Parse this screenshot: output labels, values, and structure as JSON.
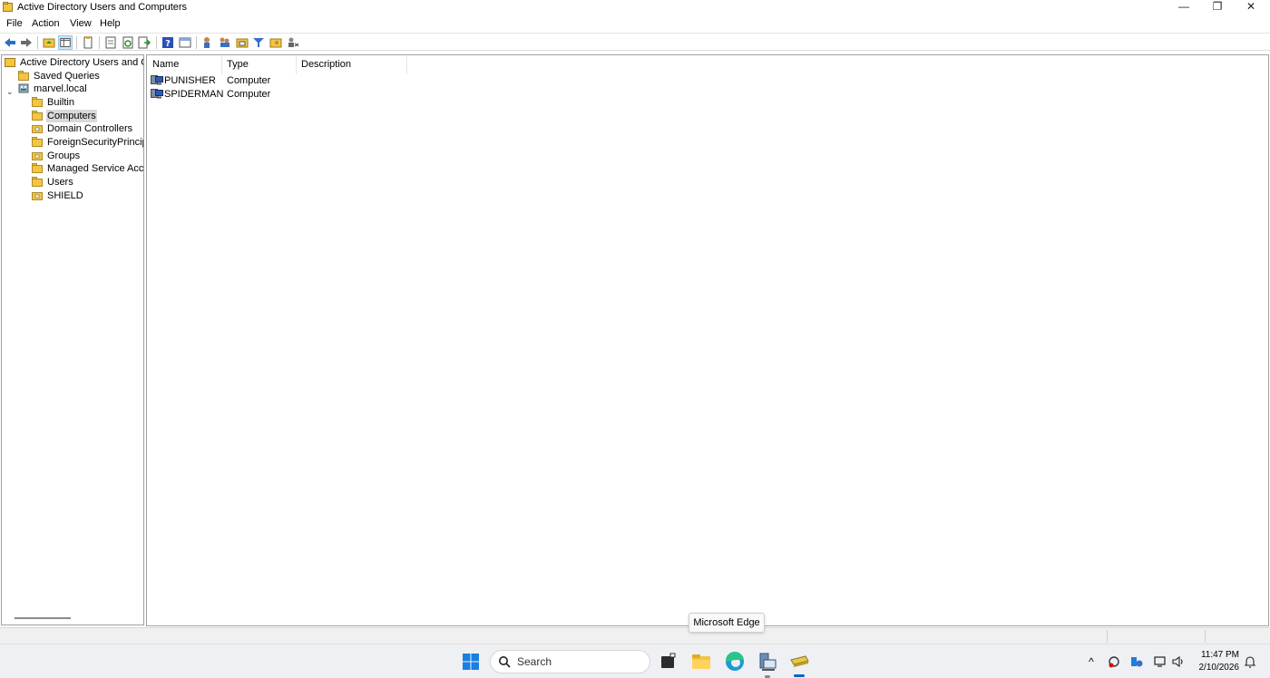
{
  "window": {
    "title": "Active Directory Users and Computers",
    "controls": {
      "minimize": "—",
      "maximize": "❐",
      "close": "✕"
    }
  },
  "menu": [
    "File",
    "Action",
    "View",
    "Help"
  ],
  "tree": {
    "root": "Active Directory Users and Com",
    "saved_queries": "Saved Queries",
    "domain": "marvel.local",
    "children": [
      "Builtin",
      "Computers",
      "Domain Controllers",
      "ForeignSecurityPrincipals",
      "Groups",
      "Managed Service Accounts",
      "Users",
      "SHIELD"
    ],
    "selected": "Computers"
  },
  "list": {
    "columns": [
      "Name",
      "Type",
      "Description"
    ],
    "rows": [
      {
        "name": "PUNISHER",
        "type": "Computer",
        "description": ""
      },
      {
        "name": "SPIDERMAN",
        "type": "Computer",
        "description": ""
      }
    ]
  },
  "tooltip": "Microsoft Edge",
  "taskbar": {
    "search_placeholder": "Search",
    "apps": [
      "start-icon",
      "terminal-icon",
      "file-explorer-icon",
      "microsoft-edge-icon",
      "server-manager-icon",
      "ad-users-computers-icon"
    ],
    "time": "11:47 PM",
    "date": "2/10/2026"
  },
  "colors": {
    "accent": "#0067c0",
    "folder": "#f4c542",
    "selection": "#d9d9d9"
  }
}
